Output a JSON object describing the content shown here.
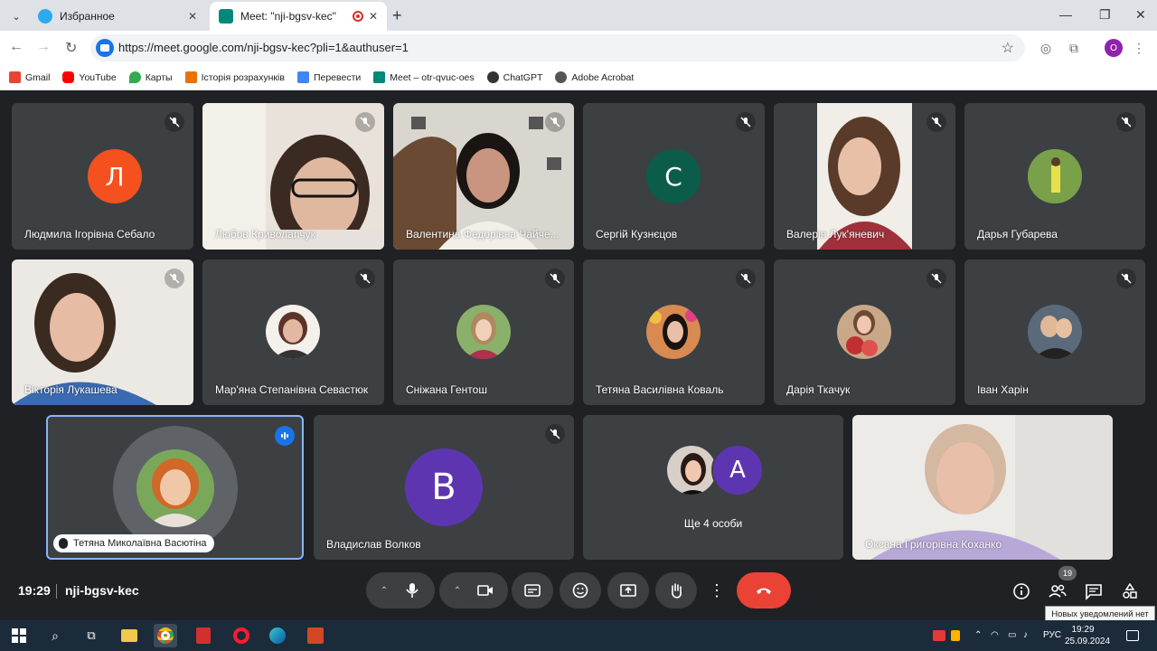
{
  "browser": {
    "tabs": [
      {
        "title": "Избранное",
        "active": false
      },
      {
        "title": "Meet: \"nji-bgsv-kec\"",
        "active": true
      }
    ],
    "url": "https://meet.google.com/nji-bgsv-kec?pli=1&authuser=1",
    "profile_initial": "O",
    "bookmarks": [
      {
        "label": "Gmail",
        "color": "#ea4335"
      },
      {
        "label": "YouTube",
        "color": "#ff0000"
      },
      {
        "label": "Карты",
        "color": "#34a853"
      },
      {
        "label": "Історія розрахунків",
        "color": "#e8710a"
      },
      {
        "label": "Перевести",
        "color": "#4285f4"
      },
      {
        "label": "Meet – otr-qvuc-oes",
        "color": "#00897b"
      },
      {
        "label": "ChatGPT",
        "color": "#333333"
      },
      {
        "label": "Adobe Acrobat",
        "color": "#444444"
      }
    ]
  },
  "meet": {
    "participants": [
      {
        "name": "Людмила Ігорівна Себало",
        "initial": "Л",
        "avatar_color": "#f4511e"
      },
      {
        "name": "Любов Криволапчук"
      },
      {
        "name": "Валентина Федорівна Чайче..."
      },
      {
        "name": "Сергій Кузнєцов",
        "initial": "С",
        "avatar_color": "#0b5d4a"
      },
      {
        "name": "Валерія Лук'яневич"
      },
      {
        "name": "Дарья Губарева"
      },
      {
        "name": "Вікторія Лукашева"
      },
      {
        "name": "Мар'яна Степанівна Севастюк"
      },
      {
        "name": "Сніжана Гентош"
      },
      {
        "name": "Тетяна Василівна Коваль"
      },
      {
        "name": "Дарія Ткачук"
      },
      {
        "name": "Іван Харін"
      },
      {
        "name": "Тетяна Миколаївна Васютіна"
      },
      {
        "name": "Владислав Волков",
        "initial": "В",
        "avatar_color": "#5e35b1"
      },
      {
        "name": "Оксана Григорівна Коханко"
      }
    ],
    "others": {
      "label": "Ще 4 особи",
      "initial": "A",
      "avatar_color": "#5e35b1"
    },
    "time": "19:29",
    "meeting_code": "nji-bgsv-kec",
    "people_count": "19",
    "tooltip": "Новых уведомлений нет"
  },
  "taskbar": {
    "lang": "РУС",
    "time": "19:29",
    "date": "25.09.2024"
  }
}
